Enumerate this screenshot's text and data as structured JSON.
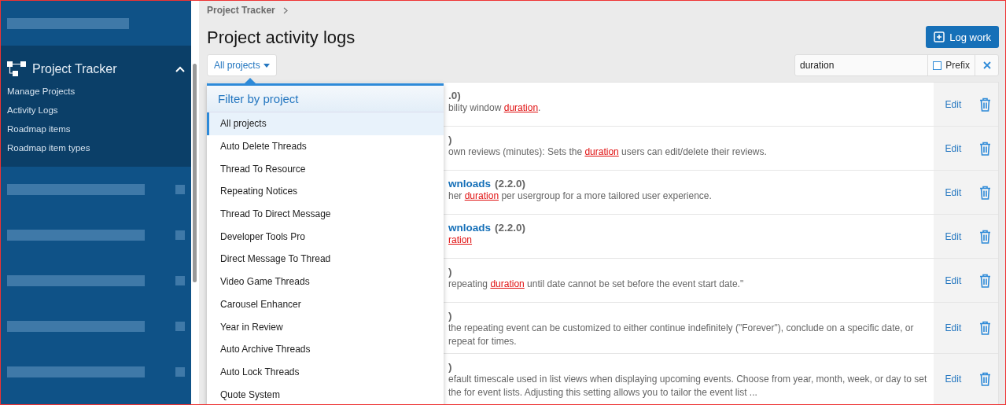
{
  "sidebar": {
    "section": {
      "title": "Project Tracker",
      "expanded": true,
      "items": [
        {
          "label": "Manage Projects"
        },
        {
          "label": "Activity Logs"
        },
        {
          "label": "Roadmap items"
        },
        {
          "label": "Roadmap item types"
        }
      ]
    }
  },
  "breadcrumb": [
    "Project Tracker"
  ],
  "page_title": "Project activity logs",
  "log_button": {
    "label": "Log work"
  },
  "filter_button": {
    "label": "All projects"
  },
  "search": {
    "value": "duration",
    "prefix_label": "Prefix",
    "prefix_checked": false
  },
  "dropdown": {
    "title": "Filter by project",
    "items": [
      {
        "label": "All projects",
        "selected": true
      },
      {
        "label": "Auto Delete Threads",
        "selected": false
      },
      {
        "label": "Thread To Resource",
        "selected": false
      },
      {
        "label": "Repeating Notices",
        "selected": false
      },
      {
        "label": "Thread To Direct Message",
        "selected": false
      },
      {
        "label": "Developer Tools Pro",
        "selected": false
      },
      {
        "label": "Direct Message To Thread",
        "selected": false
      },
      {
        "label": "Video Game Threads",
        "selected": false
      },
      {
        "label": "Carousel Enhancer",
        "selected": false
      },
      {
        "label": "Year in Review",
        "selected": false
      },
      {
        "label": "Auto Archive Threads",
        "selected": false
      },
      {
        "label": "Auto Lock Threads",
        "selected": false
      },
      {
        "label": "Quote System",
        "selected": false
      }
    ]
  },
  "rows": [
    {
      "version": ".0)",
      "description": [
        {
          "text": "bility window ",
          "highlighted": false
        },
        {
          "text": "duration",
          "highlighted": true
        },
        {
          "text": ".",
          "highlighted": false
        }
      ],
      "edit": "Edit"
    },
    {
      "version": ")",
      "description": [
        {
          "text": "own reviews (minutes): Sets the ",
          "highlighted": false
        },
        {
          "text": "duration",
          "highlighted": true
        },
        {
          "text": " users can edit/delete their reviews.",
          "highlighted": false
        }
      ],
      "edit": "Edit"
    },
    {
      "title": "wnloads",
      "version": "(2.2.0)",
      "description": [
        {
          "text": "her ",
          "highlighted": false
        },
        {
          "text": "duration",
          "highlighted": true
        },
        {
          "text": " per usergroup for a more tailored user experience.",
          "highlighted": false
        }
      ],
      "edit": "Edit"
    },
    {
      "title": "wnloads",
      "version": "(2.2.0)",
      "description": [
        {
          "text": "ration",
          "highlighted": true
        }
      ],
      "edit": "Edit"
    },
    {
      "version": ")",
      "description": [
        {
          "text": "repeating ",
          "highlighted": false
        },
        {
          "text": "duration",
          "highlighted": true
        },
        {
          "text": " until date cannot be set before the event start date.\"",
          "highlighted": false
        }
      ],
      "edit": "Edit"
    },
    {
      "version": ")",
      "description": [
        {
          "text": "the repeating event can be customized to either continue indefinitely (\"Forever\"), conclude on a specific date, or repeat for times.",
          "highlighted": false
        }
      ],
      "edit": "Edit"
    },
    {
      "version": ")",
      "description": [
        {
          "text": "efault timescale used in list views when displaying upcoming events. Choose from year, month, week, or day to set the for event lists. Adjusting this setting allows you to tailor the event list ...",
          "highlighted": false
        }
      ],
      "edit": "Edit"
    }
  ]
}
